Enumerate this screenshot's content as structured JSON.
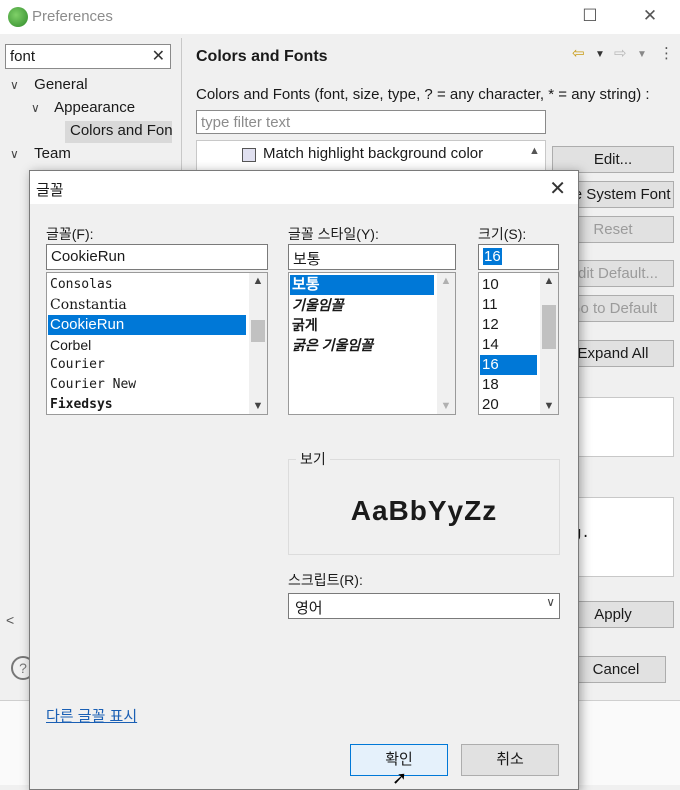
{
  "pref": {
    "title": "Preferences",
    "search_value": "font",
    "tree": [
      {
        "label": "General",
        "arrow": "∨"
      },
      {
        "label": "Appearance",
        "arrow": "∨"
      },
      {
        "label": "Colors and Fonts",
        "arrow": ""
      },
      {
        "label": "Team",
        "arrow": "∨"
      }
    ],
    "right_title": "Colors and Fonts",
    "description": "Colors and Fonts (font, size, type, ? = any character, * = any string) :",
    "filter_placeholder": "type filter text",
    "list_item": "Match highlight background color",
    "buttons": {
      "edit": "Edit...",
      "system_font": "Use System Font",
      "reset": "Reset",
      "edit_default": "Edit Default...",
      "go_to_default": "Go to Default",
      "expand_all": "Expand All",
      "apply": "Apply",
      "cancel": "Cancel"
    },
    "preview_fragment": "g."
  },
  "font_dialog": {
    "title": "글꼴",
    "font_label": "글꼴(F):",
    "font_value": "CookieRun",
    "fonts": [
      "Consolas",
      "Constantia",
      "CookieRun",
      "Corbel",
      "Courier",
      "Courier New",
      "Fixedsys"
    ],
    "selected_font_index": 2,
    "style_label": "글꼴 스타일(Y):",
    "style_value": "보통",
    "styles": [
      "보통",
      "기울임꼴",
      "굵게",
      "굵은 기울임꼴"
    ],
    "selected_style_index": 0,
    "size_label": "크기(S):",
    "size_value": "16",
    "sizes": [
      "10",
      "11",
      "12",
      "14",
      "16",
      "18",
      "20"
    ],
    "selected_size_index": 4,
    "sample_label": "보기",
    "sample_text": "AaBbYyZz",
    "script_label": "스크립트(R):",
    "script_value": "영어",
    "more_fonts_link": "다른 글꼴 표시",
    "ok": "확인",
    "cancel": "취소"
  }
}
